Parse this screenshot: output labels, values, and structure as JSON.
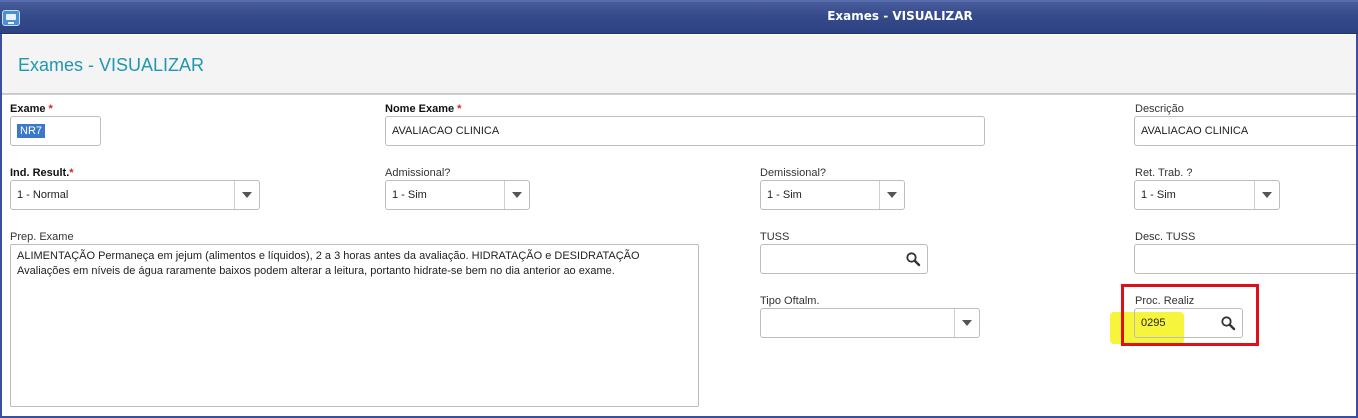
{
  "window": {
    "title": "Exames - VISUALIZAR"
  },
  "header": {
    "title": "Exames - VISUALIZAR"
  },
  "fields": {
    "exame": {
      "label": "Exame",
      "value": "NR7"
    },
    "nome_exame": {
      "label": "Nome Exame",
      "value": "AVALIACAO CLINICA"
    },
    "descricao": {
      "label": "Descrição",
      "value": "AVALIACAO CLINICA"
    },
    "ind_result": {
      "label": "Ind. Result.",
      "value": "1 - Normal"
    },
    "admissional": {
      "label": "Admissional?",
      "value": "1 - Sim"
    },
    "demissional": {
      "label": "Demissional?",
      "value": "1 - Sim"
    },
    "ret_trab": {
      "label": "Ret. Trab. ?",
      "value": "1 - Sim"
    },
    "prep_exame": {
      "label": "Prep. Exame",
      "value": "ALIMENTAÇÃO Permaneça em jejum (alimentos e líquidos), 2 a 3 horas antes da avaliação. HIDRATAÇÃO e DESIDRATAÇÃO Avaliações em níveis de água raramente baixos podem alterar a leitura, portanto hidrate-se bem no dia anterior ao exame."
    },
    "tuss": {
      "label": "TUSS",
      "value": ""
    },
    "desc_tuss": {
      "label": "Desc. TUSS",
      "value": ""
    },
    "tipo_oftalm": {
      "label": "Tipo Oftalm.",
      "value": ""
    },
    "proc_realiz": {
      "label": "Proc. Realiz",
      "value": "0295"
    }
  },
  "required_marker": "*",
  "icons": {
    "app": "app-window-icon",
    "lookup": "search-icon",
    "dropdown": "chevron-down-icon"
  },
  "colors": {
    "titlebar": "#354a8a",
    "header_title": "#1f97b0",
    "required": "#e0201a",
    "highlight_box": "#e0101a",
    "marker": "#f5f31a"
  }
}
